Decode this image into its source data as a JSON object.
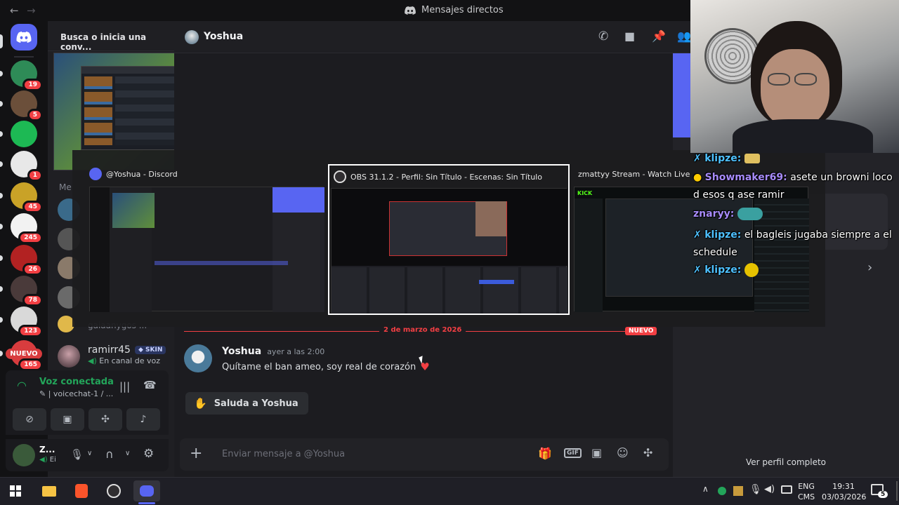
{
  "window": {
    "title": "Mensajes directos"
  },
  "sidebar": {
    "search_placeholder": "Busca o inicia una conv...",
    "dm_partial_1": "Me",
    "dm_partial_2": "gaiaanygos ...",
    "dm_item": {
      "name": "ramirr45",
      "tag": "SKIN",
      "status": "En canal de voz"
    }
  },
  "servers": [
    {
      "badge": "19",
      "color": "#2e8b57"
    },
    {
      "badge": "5",
      "color": "#6b4f3a"
    },
    {
      "badge": "",
      "color": "#1db954"
    },
    {
      "badge": "1",
      "color": "#e8e8e8"
    },
    {
      "badge": "45",
      "color": "#c9a227"
    },
    {
      "badge": "245",
      "color": "#f2f2f2"
    },
    {
      "badge": "26",
      "color": "#b22222"
    },
    {
      "badge": "78",
      "color": "#4a3a3a"
    },
    {
      "badge": "123",
      "color": "#d9d9d9"
    },
    {
      "badge": "165",
      "label": "NUEVO",
      "color": "#d83c3e"
    }
  ],
  "voice": {
    "status": "Voz conectada",
    "channel": "| voicechat-1 / ..."
  },
  "user": {
    "name": "Z...",
    "sub": "Ei"
  },
  "header": {
    "name": "Yoshua"
  },
  "chat": {
    "date_divider": "2 de marzo de 2026",
    "new_badge": "NUEVO",
    "message": {
      "author": "Yoshua",
      "time": "ayer a las 2:00",
      "text": "Quítame el ban ameo, soy real de corazón"
    },
    "wave_button": "Saluda a Yoshua",
    "input_placeholder": "Enviar mensaje a @Yoshua"
  },
  "profile": {
    "view_full": "Ver perfil completo"
  },
  "alttab": {
    "windows": [
      {
        "title": "@Yoshua - Discord",
        "icon": "discord-icon"
      },
      {
        "title": "OBS 31.1.2 - Perfil: Sin Título - Escenas: Sin Título",
        "icon": "obs-icon",
        "selected": true
      },
      {
        "title": "zmattyy Stream - Watch Live on Kick - Brave",
        "icon": "brave-icon"
      }
    ]
  },
  "stream_chat": [
    {
      "user": "klipze:",
      "text": "",
      "color": "#4ec1ff"
    },
    {
      "user": "Showmaker69:",
      "text": "asete un browni loco d esos q ase ramir",
      "color": "#a78bfa"
    },
    {
      "user": "znaryy:",
      "text": "",
      "color": "#a78bfa"
    },
    {
      "user": "klipze:",
      "text": "el bagleis jugaba siempre a el schedule",
      "color": "#4ec1ff"
    },
    {
      "user": "klipze:",
      "text": "",
      "color": "#4ec1ff"
    }
  ],
  "taskbar": {
    "lang_1": "ENG",
    "lang_2": "CMS",
    "time": "19:31",
    "date": "03/03/2026",
    "notif_count": "5"
  },
  "colors": {
    "accent": "#5865f2",
    "voice_green": "#23a55a",
    "danger": "#f23f43"
  }
}
